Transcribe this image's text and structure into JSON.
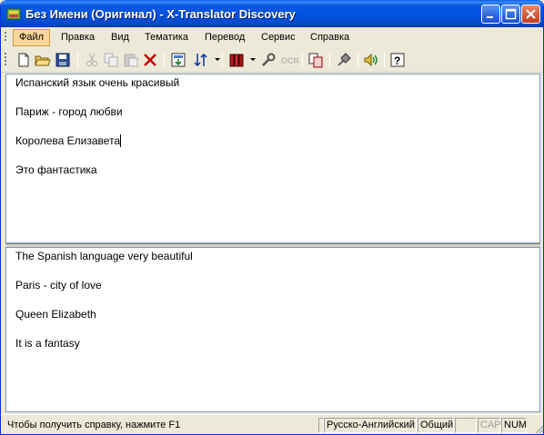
{
  "window": {
    "title": "Без Имени (Оригинал) - X-Translator Discovery",
    "titlebar_color": "#0453dc",
    "close_color": "#d4573a"
  },
  "menu": {
    "items": [
      {
        "label": "Файл",
        "active": true
      },
      {
        "label": "Правка"
      },
      {
        "label": "Вид"
      },
      {
        "label": "Тематика"
      },
      {
        "label": "Перевод"
      },
      {
        "label": "Сервис"
      },
      {
        "label": "Справка"
      }
    ]
  },
  "toolbar": {
    "icons": [
      "new-document-icon",
      "open-folder-icon",
      "save-icon",
      "cut-icon",
      "copy-icon",
      "paste-icon",
      "delete-icon",
      "translate-icon",
      "sort-direction-icon",
      "dictionary-books-icon",
      "wrench-icon",
      "ocr-icon",
      "copy-pages-icon",
      "pin-icon",
      "speaker-icon",
      "help-icon"
    ],
    "ocr_label": "OCR"
  },
  "source_pane": {
    "lines": [
      "Испанский язык очень красивый",
      "Париж - город любви",
      "Королева Елизавета",
      "Это фантастика"
    ]
  },
  "target_pane": {
    "lines": [
      "The Spanish language very beautiful",
      "Paris - city of love",
      "Queen Elizabeth",
      "It is a fantasy"
    ]
  },
  "statusbar": {
    "help_text": "Чтобы получить справку, нажмите F1",
    "direction": "Русско-Английский",
    "topic": "Общий",
    "caps": "CAP",
    "num": "NUM"
  }
}
